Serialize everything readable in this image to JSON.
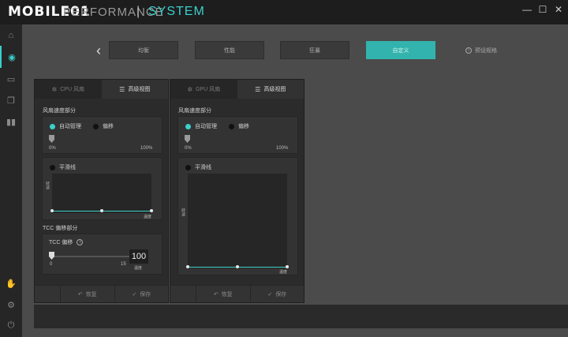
{
  "titlebar": {
    "logo": "MOBILE01",
    "brand_left": "PERFORMANCE",
    "separator": "|",
    "brand_right": "SYSTEM",
    "minimize": "—",
    "maximize": "☐",
    "close": "✕"
  },
  "sidebar": {
    "items": [
      {
        "icon": "home-icon",
        "glyph": "⌂"
      },
      {
        "icon": "performance-icon",
        "glyph": "◉"
      },
      {
        "icon": "monitor-icon",
        "glyph": "▭"
      },
      {
        "icon": "layers-icon",
        "glyph": "❐"
      },
      {
        "icon": "split-icon",
        "glyph": "▮▮"
      },
      {
        "icon": "thumb-icon",
        "glyph": "✋"
      },
      {
        "icon": "settings-icon",
        "glyph": "⚙"
      },
      {
        "icon": "power-icon",
        "glyph": "⏻"
      }
    ]
  },
  "nav": {
    "back": "‹",
    "buttons": [
      "均衡",
      "性能",
      "狂暴",
      "自定义"
    ],
    "active_index": 3,
    "preset_label": "预设规格"
  },
  "cpu_panel": {
    "tab_basic": "CPU 风扇",
    "tab_advanced": "高级视图",
    "fan_section": "风扇速度部分",
    "auto_label": "自动管理",
    "offset_label": "偏移",
    "min_label": "0%",
    "max_label": "100%",
    "smooth_label": "平滑线",
    "axis_speed": "转速",
    "axis_temp": "温度",
    "tcc_section": "TCC 偏移部分",
    "tcc_title": "TCC 偏移",
    "tcc_min": "0",
    "tcc_max": "15",
    "tcc_value": "100",
    "tcc_unit": "温度",
    "restore": "恢复",
    "save": "保存"
  },
  "gpu_panel": {
    "tab_basic": "GPU 风扇",
    "tab_advanced": "高级视图",
    "fan_section": "风扇速度部分",
    "auto_label": "自动管理",
    "offset_label": "偏移",
    "min_label": "0%",
    "max_label": "100%",
    "smooth_label": "平滑线",
    "axis_speed": "转速",
    "axis_temp": "温度",
    "restore": "恢复",
    "save": "保存"
  },
  "colors": {
    "accent": "#3ad0cc",
    "active_button": "#33b3ad"
  }
}
